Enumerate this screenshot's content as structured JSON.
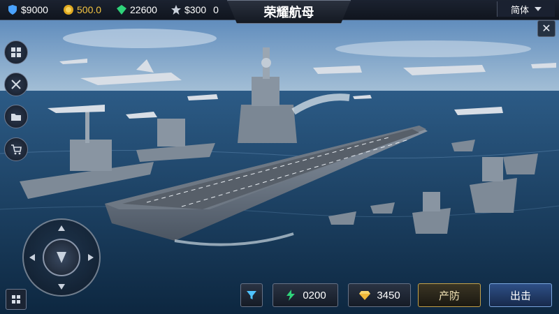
{
  "top_bar": {
    "resources": [
      {
        "icon": "shield-dollar-icon",
        "value": "$9000"
      },
      {
        "icon": "gold-coin-icon",
        "value": "500.0"
      },
      {
        "icon": "green-gem-icon",
        "value": "22600"
      },
      {
        "icon": "star-icon",
        "value": "$300"
      },
      {
        "icon": "",
        "value": "0"
      }
    ],
    "title": "荣耀航母",
    "language": "简体"
  },
  "left_menu": [
    {
      "icon": "layout-grid-icon"
    },
    {
      "icon": "crossed-swords-icon"
    },
    {
      "icon": "folder-icon"
    },
    {
      "icon": "shop-cart-icon"
    }
  ],
  "bottom_bar": {
    "energy": "0200",
    "gems": "3450",
    "defense_label": "产防",
    "battle_label": "出击"
  },
  "colors": {
    "accent_gold": "#f4c542",
    "gem_green": "#2fd37a",
    "battle_blue": "#2e4f86"
  }
}
